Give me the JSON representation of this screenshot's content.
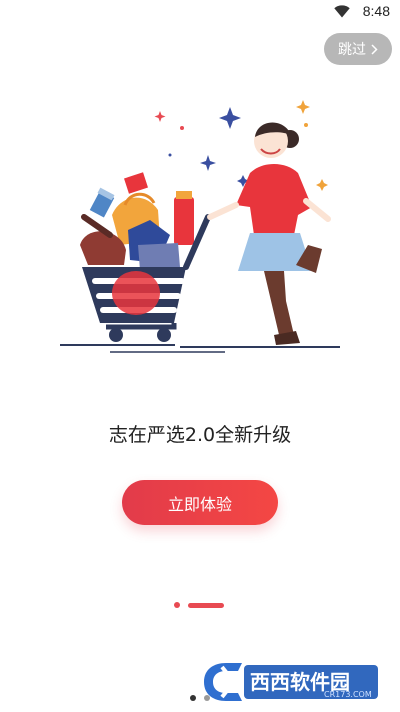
{
  "status_bar": {
    "time": "8:48"
  },
  "skip_button": {
    "label": "跳过"
  },
  "headline": "志在严选2.0全新升级",
  "cta_button": {
    "label": "立即体验"
  },
  "page_indicator": {
    "current": 2,
    "total": 2
  },
  "watermark": {
    "brand": "西西软件园",
    "domain": "CR173.COM"
  },
  "colors": {
    "accent": "#e84a52",
    "skip_bg": "#b7b7b7",
    "cart": "#2e3a5c"
  },
  "icons": {
    "wifi": "wifi-icon",
    "chevron": "chevron-right-icon"
  }
}
